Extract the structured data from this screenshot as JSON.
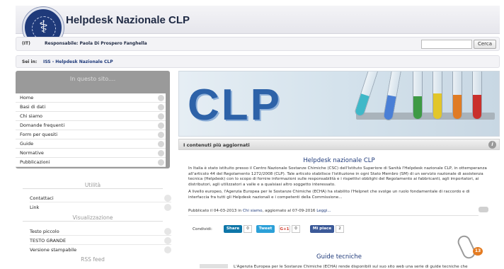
{
  "header": {
    "title": "Helpdesk Nazionale CLP"
  },
  "infobar": {
    "lang": "(IT)",
    "responsabile_label": "Responsabile: Paola Di Prospero Fanghella",
    "search_placeholder": "",
    "search_button": "Cerca"
  },
  "breadcrumb": {
    "sei_in": "Sei in:",
    "path": "ISS - Helpdesk Nazionale CLP"
  },
  "sidebar": {
    "nav_title": "In questo sito....",
    "nav_items": [
      {
        "label": "Home"
      },
      {
        "label": "Basi di dati"
      },
      {
        "label": "Chi siamo"
      },
      {
        "label": "Domande frequenti"
      },
      {
        "label": "Form per quesiti"
      },
      {
        "label": "Guide"
      },
      {
        "label": "Normative"
      },
      {
        "label": "Pubblicazioni"
      }
    ],
    "utilita_title": "Utilità",
    "utilita_items": [
      {
        "label": "Contattaci"
      },
      {
        "label": "Link"
      }
    ],
    "visual_title": "Visualizzazione",
    "visual_items": [
      {
        "label": "Testo piccolo"
      },
      {
        "label": "TESTO GRANDE"
      },
      {
        "label": "Versione stampabile"
      }
    ],
    "rss_title": "RSS feed"
  },
  "main": {
    "banner_text": "CLP",
    "section_title": "I contenuti più aggiornati",
    "article": {
      "title": "Helpdesk nazionale CLP",
      "para1": "In Italia è stato istituito presso il Centro Nazionale Sostanze Chimiche (CSC) dell'Istituto Superiore di Sanità l'Helpdesk nazionale CLP, in ottemperanza all'articolo 44 del Regolamento 1272/2008 (CLP). Tale articolo stabilisce l'istituzione in ogni Stato Membro (SM) di un servizio nazionale di assistenza tecnica (Helpdesk) con lo scopo di fornire informazioni sulle responsabilità e i rispettivi obblighi del Regolamento ai fabbricanti, agli importatori, ai distributori, agli utilizzatori a valle e a qualsiasi altro soggetto interessato.",
      "para2": "A livello europeo, l'Agenzia Europea per le Sostanze Chimiche (ECHA) ha stabilito l'Helpnet che svolge un ruolo fondamentale di raccordo e di interfaccia fra tutti gli Helpdesk nazionali e i competenti della Commissione...",
      "meta_prefix": "Pubblicato il 04-03-2013 in",
      "meta_link": "Chi siamo",
      "meta_suffix": ", aggiornato al 07-09-2016",
      "meta_more": "Leggi..."
    },
    "share": {
      "label": "Condividi:",
      "linkedin_label": "Share",
      "linkedin_count": "0",
      "tweet_label": "Tweet",
      "gplus_label": "G+1",
      "gplus_count": "0",
      "fb_label": "Mi piace",
      "fb_count": "2"
    },
    "guide": {
      "title": "Guide tecniche",
      "badge": "13",
      "text": "L'Agenzia Europea per le Sostanze Chimiche (ECHA) rende disponibili sul suo sito web una serie di guide tecniche che"
    }
  },
  "colors": {
    "brand_blue": "#1f3a7a",
    "banner_blue": "#2d62a8",
    "sidebar_grey": "#9a9a9a",
    "badge_orange": "#e47b21"
  }
}
